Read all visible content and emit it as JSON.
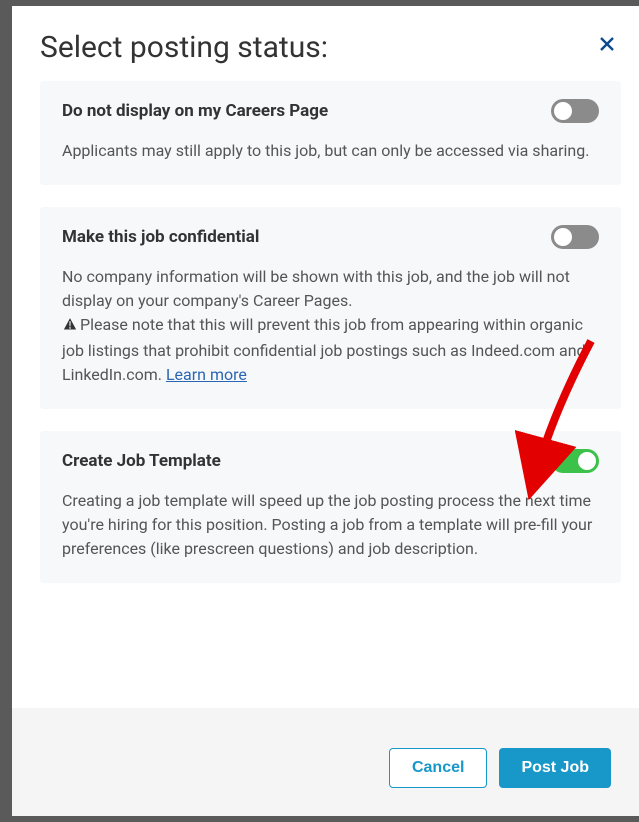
{
  "modal": {
    "title": "Select posting status:",
    "close_label": "Close"
  },
  "options": {
    "doNotDisplay": {
      "title": "Do not display on my Careers Page",
      "description": "Applicants may still apply to this job, but can only be accessed via sharing.",
      "enabled": false
    },
    "confidential": {
      "title": "Make this job confidential",
      "description_intro": "No company information will be shown with this job, and the job will not display on your company's Career Pages.",
      "warning_text": "Please note that this will prevent this job from appearing within organic job listings that prohibit confidential job postings such as Indeed.com and LinkedIn.com. ",
      "learn_more": "Learn more",
      "enabled": false
    },
    "template": {
      "title": "Create Job Template",
      "description": "Creating a job template will speed up the job posting process the next time you're hiring for this position. Posting a job from a template will pre-fill your preferences (like prescreen questions) and job description.",
      "enabled": true
    }
  },
  "footer": {
    "cancel": "Cancel",
    "post": "Post Job"
  }
}
